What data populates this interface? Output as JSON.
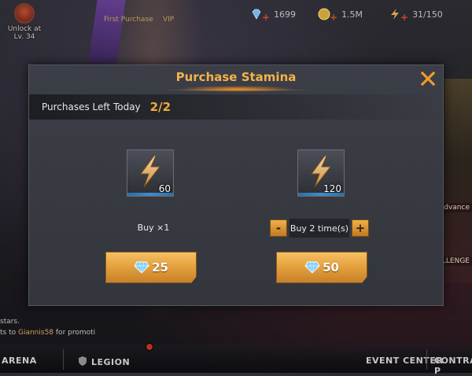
{
  "hud": {
    "unlock_line1": "Unlock at",
    "unlock_line2": "Lv. 34",
    "first_purchase": "First Purchase",
    "vip": "VIP",
    "gems": "1699",
    "gold": "1.5M",
    "stamina": "31/150"
  },
  "side_tags": [
    "Advance",
    "LLENGE"
  ],
  "chat": {
    "line1": "stars.",
    "line2_prefix": "ts to ",
    "line2_name": "Giannis58",
    "line2_suffix": " for promoti"
  },
  "nav": {
    "arena": "ARENA",
    "legion": "LEGION",
    "event_center": "EVENT CENTER",
    "contra": "CONTRA P"
  },
  "modal": {
    "title": "Purchase Stamina",
    "purchases_label": "Purchases Left Today",
    "purchases_value": "2/2",
    "option_single": {
      "quantity": "60",
      "label": "Buy ×1",
      "price": "25"
    },
    "option_multi": {
      "quantity": "120",
      "minus": "-",
      "count_label": "Buy 2 time(s)",
      "plus": "+",
      "price": "50"
    }
  },
  "colors": {
    "accent_orange": "#f4b24a",
    "button_gold": "#e6a23e",
    "gem_blue": "#6ec6ff"
  }
}
